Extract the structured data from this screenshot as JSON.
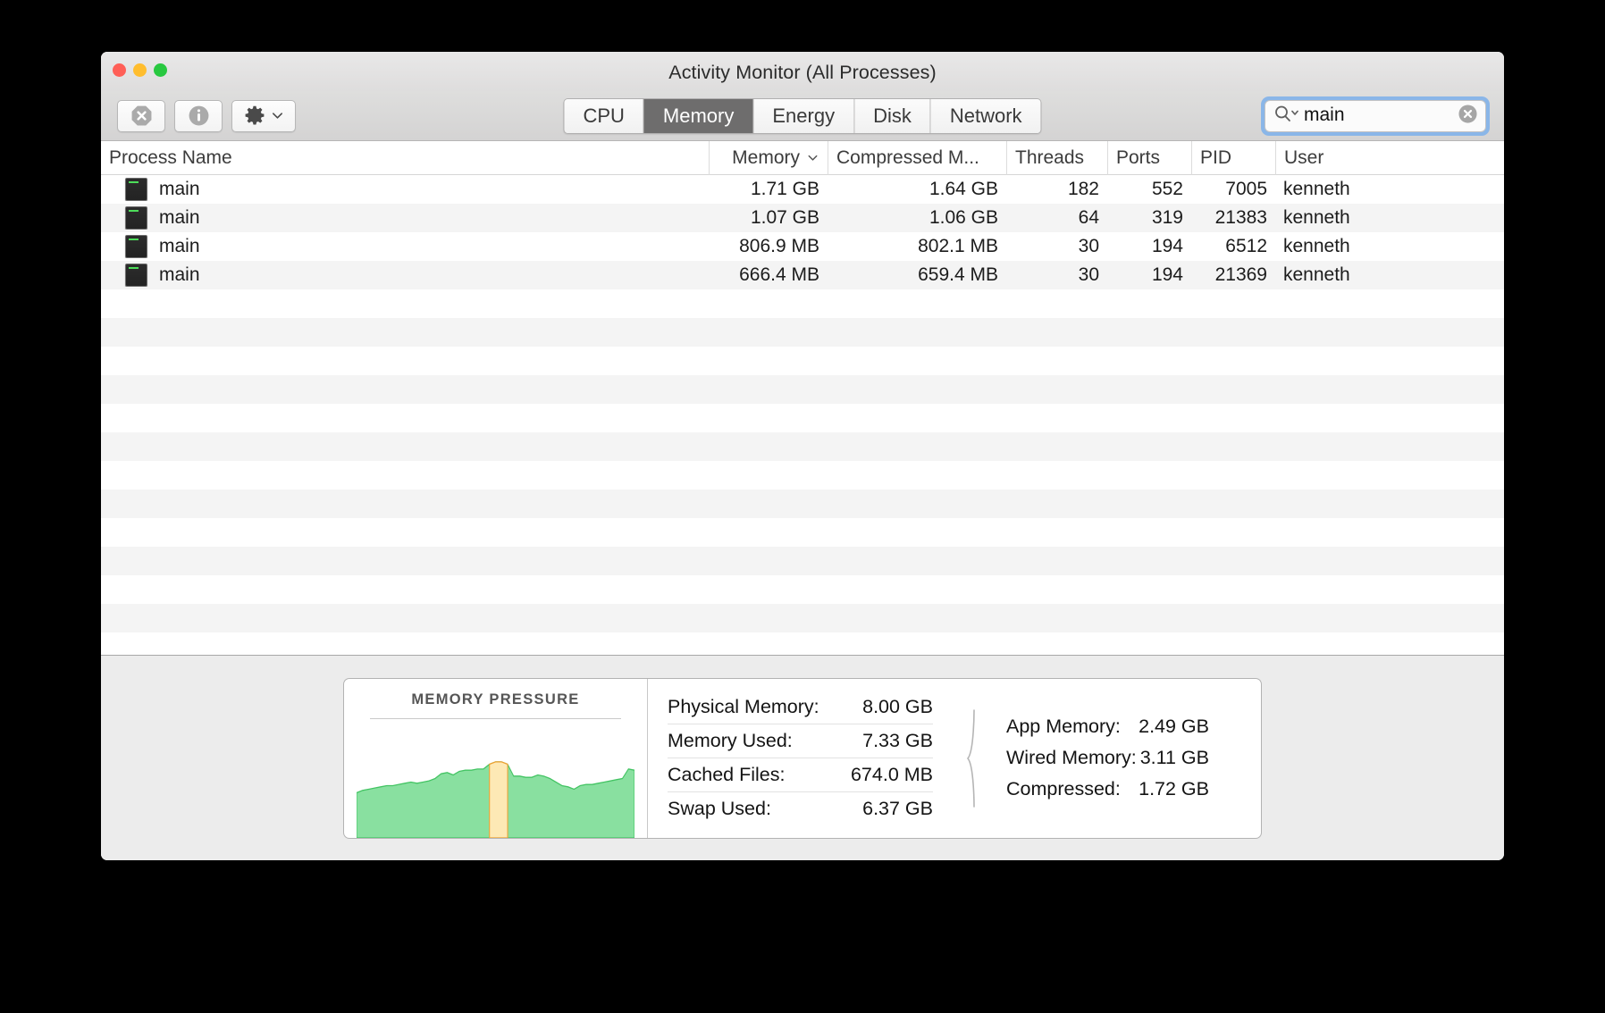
{
  "window": {
    "title": "Activity Monitor (All Processes)",
    "traffic_lights": [
      {
        "name": "close",
        "color": "#ff5f57"
      },
      {
        "name": "minimize",
        "color": "#ffbd2e"
      },
      {
        "name": "zoom",
        "color": "#28c840"
      }
    ]
  },
  "toolbar": {
    "quit_process_label": "Quit Process",
    "inspect_label": "Inspect",
    "gear_label": "Actions",
    "tabs": [
      {
        "label": "CPU",
        "active": false
      },
      {
        "label": "Memory",
        "active": true
      },
      {
        "label": "Energy",
        "active": false
      },
      {
        "label": "Disk",
        "active": false
      },
      {
        "label": "Network",
        "active": false
      }
    ],
    "search": {
      "value": "main",
      "placeholder": "Search"
    }
  },
  "table": {
    "columns": [
      {
        "key": "name",
        "label": "Process Name",
        "align": "left",
        "sorted": false
      },
      {
        "key": "mem",
        "label": "Memory",
        "align": "right",
        "sorted": true,
        "sort_dir": "desc"
      },
      {
        "key": "comp",
        "label": "Compressed M...",
        "align": "right",
        "sorted": false
      },
      {
        "key": "thr",
        "label": "Threads",
        "align": "right",
        "sorted": false
      },
      {
        "key": "ports",
        "label": "Ports",
        "align": "right",
        "sorted": false
      },
      {
        "key": "pid",
        "label": "PID",
        "align": "right",
        "sorted": false
      },
      {
        "key": "user",
        "label": "User",
        "align": "left",
        "sorted": false
      }
    ],
    "rows": [
      {
        "name": "main",
        "mem": "1.71 GB",
        "comp": "1.64 GB",
        "thr": "182",
        "ports": "552",
        "pid": "7005",
        "user": "kenneth"
      },
      {
        "name": "main",
        "mem": "1.07 GB",
        "comp": "1.06 GB",
        "thr": "64",
        "ports": "319",
        "pid": "21383",
        "user": "kenneth"
      },
      {
        "name": "main",
        "mem": "806.9 MB",
        "comp": "802.1 MB",
        "thr": "30",
        "ports": "194",
        "pid": "6512",
        "user": "kenneth"
      },
      {
        "name": "main",
        "mem": "666.4 MB",
        "comp": "659.4 MB",
        "thr": "30",
        "ports": "194",
        "pid": "21369",
        "user": "kenneth"
      }
    ],
    "empty_row_count": 12
  },
  "footer": {
    "pressure": {
      "title": "MEMORY PRESSURE",
      "green_color": "#89e0a0",
      "green_stroke": "#43c463",
      "warn_color": "#fde9b5",
      "warn_stroke": "#f0a030"
    },
    "stats_left": [
      {
        "label": "Physical Memory:",
        "value": "8.00 GB"
      },
      {
        "label": "Memory Used:",
        "value": "7.33 GB"
      },
      {
        "label": "Cached Files:",
        "value": "674.0 MB"
      },
      {
        "label": "Swap Used:",
        "value": "6.37 GB"
      }
    ],
    "stats_right": [
      {
        "label": "App Memory:",
        "value": "2.49 GB"
      },
      {
        "label": "Wired Memory:",
        "value": "3.11 GB"
      },
      {
        "label": "Compressed:",
        "value": "1.72 GB"
      }
    ]
  },
  "chart_data": {
    "type": "area",
    "title": "MEMORY PRESSURE",
    "xlabel": "",
    "ylabel": "",
    "ylim": [
      0,
      100
    ],
    "series": [
      {
        "name": "Memory Pressure",
        "values": [
          38,
          40,
          41,
          42,
          43,
          44,
          44,
          45,
          46,
          47,
          46,
          47,
          48,
          50,
          54,
          55,
          53,
          56,
          57,
          57,
          58,
          58,
          62,
          64,
          64,
          62,
          52,
          52,
          51,
          51,
          53,
          52,
          50,
          47,
          44,
          43,
          41,
          44,
          45,
          45,
          46,
          47,
          48,
          49,
          50,
          58,
          57
        ]
      }
    ],
    "warning_band": {
      "start_index": 22,
      "end_index": 25,
      "color": "#fde9b5"
    }
  }
}
